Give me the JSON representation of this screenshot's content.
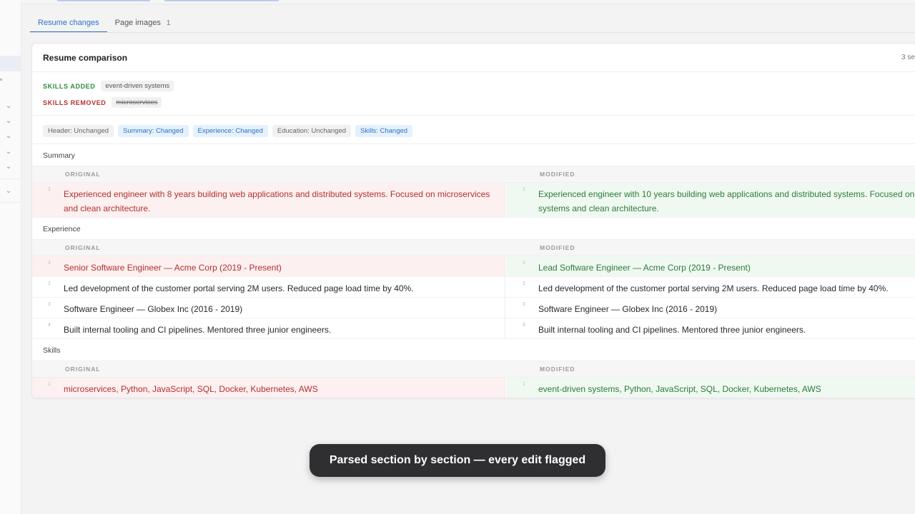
{
  "tabs": [
    {
      "label": "Resume changes",
      "active": true
    },
    {
      "label": "Page images",
      "count": "1"
    }
  ],
  "card": {
    "title": "Resume comparison",
    "meta": "3 se"
  },
  "skills": {
    "added_label": "SKILLS ADDED",
    "added": [
      "event-driven systems"
    ],
    "removed_label": "SKILLS REMOVED",
    "removed": [
      "microservices"
    ]
  },
  "sections_status": [
    {
      "label": "Header: Unchanged",
      "changed": false
    },
    {
      "label": "Summary: Changed",
      "changed": true
    },
    {
      "label": "Experience: Changed",
      "changed": true
    },
    {
      "label": "Education: Unchanged",
      "changed": false
    },
    {
      "label": "Skills: Changed",
      "changed": true
    }
  ],
  "diff": {
    "original_label": "ORIGINAL",
    "modified_label": "MODIFIED",
    "sections": [
      {
        "name": "Summary",
        "rows": [
          {
            "line": "1",
            "original": [
              "Experienced engineer with 8 years building web applications and distributed systems. Focused on microservices",
              "and clean architecture."
            ],
            "modified": [
              "Experienced engineer with 10 years building web applications and distributed systems. Focused on",
              "systems and clean architecture."
            ],
            "changed": true
          }
        ]
      },
      {
        "name": "Experience",
        "rows": [
          {
            "line": "1",
            "original": [
              "Senior Software Engineer — Acme Corp (2019 - Present)"
            ],
            "modified": [
              "Lead Software Engineer — Acme Corp (2019 - Present)"
            ],
            "changed": true
          },
          {
            "line": "2",
            "original": [
              "Led development of the customer portal serving 2M users. Reduced page load time by 40%."
            ],
            "modified": [
              "Led development of the customer portal serving 2M users. Reduced page load time by 40%."
            ],
            "changed": false
          },
          {
            "line": "3",
            "original": [
              "Software Engineer — Globex Inc (2016 - 2019)"
            ],
            "modified": [
              "Software Engineer — Globex Inc (2016 - 2019)"
            ],
            "changed": false
          },
          {
            "line": "4",
            "original": [
              "Built internal tooling and CI pipelines. Mentored three junior engineers."
            ],
            "modified": [
              "Built internal tooling and CI pipelines. Mentored three junior engineers."
            ],
            "changed": false
          }
        ]
      },
      {
        "name": "Skills",
        "rows": [
          {
            "line": "1",
            "original": [
              "microservices, Python, JavaScript, SQL, Docker, Kubernetes, AWS"
            ],
            "modified": [
              "event-driven systems, Python, JavaScript, SQL, Docker, Kubernetes, AWS"
            ],
            "changed": true
          }
        ]
      }
    ]
  },
  "toast": "Parsed section by section — every edit flagged",
  "colors": {
    "accent": "#2b72c9",
    "added": "#2d8a3f",
    "removed": "#b3302f"
  }
}
